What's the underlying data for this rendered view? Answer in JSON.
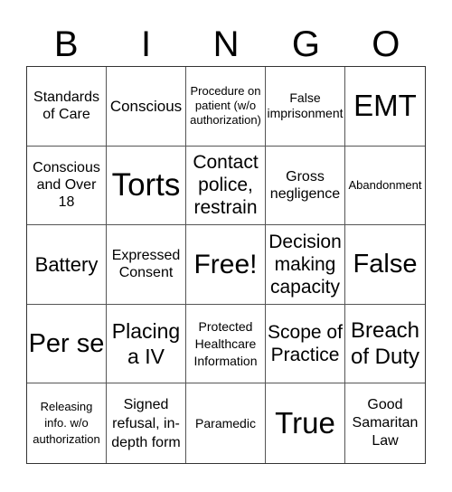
{
  "header": {
    "letters": [
      "B",
      "I",
      "N",
      "G",
      "O"
    ]
  },
  "cells": [
    "Standards of Care",
    "Conscious",
    "Procedure on patient (w/o authorization)",
    "False imprisonment",
    "EMT",
    "Conscious and Over 18",
    "Torts",
    "Contact police, restrain",
    "Gross negligence",
    "Abandonment",
    "Battery",
    "Expressed Consent",
    "Free!",
    "Decision making capacity",
    "False",
    "Per se",
    "Placing a IV",
    "Protected Healthcare Information",
    "Scope of Practice",
    "Breach of Duty",
    "Releasing info. w/o authorization",
    "Signed refusal, in-depth form",
    "Paramedic",
    "True",
    "Good Samaritan Law"
  ]
}
